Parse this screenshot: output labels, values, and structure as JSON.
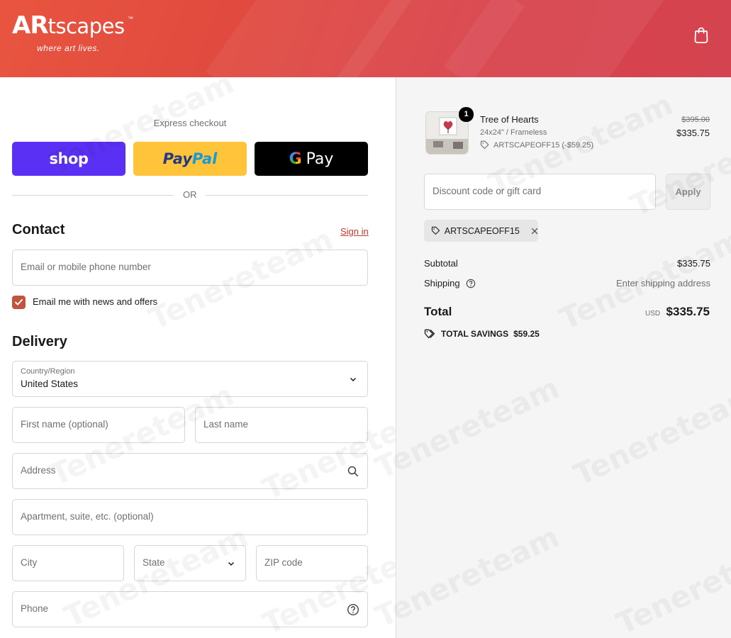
{
  "brand": {
    "name_caps": "AR",
    "name_rest": "tscapes",
    "tm": "™",
    "tagline": "where art lives."
  },
  "express": {
    "title": "Express checkout",
    "shop_label": "shop",
    "paypal_part1": "Pay",
    "paypal_part2": "Pal",
    "gpay_g": "G",
    "gpay_label": "Pay",
    "or": "OR"
  },
  "contact": {
    "heading": "Contact",
    "signin": "Sign in",
    "email_placeholder": "Email or mobile phone number",
    "newsletter_label": "Email me with news and offers",
    "newsletter_checked": true
  },
  "delivery": {
    "heading": "Delivery",
    "country_label": "Country/Region",
    "country_value": "United States",
    "first_name": "First name (optional)",
    "last_name": "Last name",
    "address": "Address",
    "apartment": "Apartment, suite, etc. (optional)",
    "city": "City",
    "state": "State",
    "zip": "ZIP code",
    "phone": "Phone"
  },
  "cart": {
    "item": {
      "quantity": "1",
      "name": "Tree of Hearts",
      "variant": "24x24\" / Frameless",
      "discount": "ARTSCAPEOFF15 (-$59.25)",
      "old_price": "$395.00",
      "price": "$335.75"
    },
    "discount_placeholder": "Discount code or gift card",
    "apply_label": "Apply",
    "applied_code": "ARTSCAPEOFF15",
    "subtotal_label": "Subtotal",
    "subtotal_value": "$335.75",
    "shipping_label": "Shipping",
    "shipping_value": "Enter shipping address",
    "total_label": "Total",
    "currency": "USD",
    "total_value": "$335.75",
    "savings_label": "TOTAL SAVINGS",
    "savings_value": "$59.25"
  },
  "watermark": "Tenereteam",
  "colors": {
    "header": "#e0493f",
    "shop": "#5a31f4",
    "paypal": "#ffc439",
    "accent": "#c2533d"
  }
}
